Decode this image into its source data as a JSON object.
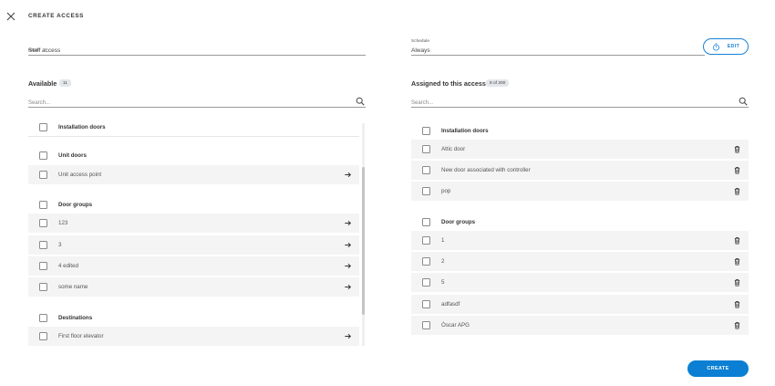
{
  "header": {
    "title": "CREATE ACCESS"
  },
  "name_field": {
    "label": "Name",
    "required_mark": "*",
    "value": "Staff access"
  },
  "schedule_field": {
    "label": "Schedule",
    "value": "Always",
    "edit_label": "EDIT"
  },
  "available": {
    "title": "Available",
    "count": "11",
    "search_placeholder": "Search...",
    "rows": [
      {
        "type": "group",
        "label": "Installation doors"
      },
      {
        "type": "group",
        "label": "Unit doors"
      },
      {
        "type": "item",
        "label": "Unit access point"
      },
      {
        "type": "group",
        "label": "Door groups"
      },
      {
        "type": "item",
        "label": "123"
      },
      {
        "type": "item",
        "label": "3"
      },
      {
        "type": "item",
        "label": "4 edited"
      },
      {
        "type": "item",
        "label": "some name"
      },
      {
        "type": "group",
        "label": "Destinations"
      },
      {
        "type": "item",
        "label": "First floor elevator"
      }
    ]
  },
  "assigned": {
    "title": "Assigned to this access",
    "count": "8 of 200",
    "search_placeholder": "Search...",
    "rows": [
      {
        "type": "group",
        "label": "Installation doors"
      },
      {
        "type": "item",
        "label": "Attic door"
      },
      {
        "type": "item",
        "label": "New door associated with controller"
      },
      {
        "type": "item",
        "label": "pop"
      },
      {
        "type": "group",
        "label": "Door groups"
      },
      {
        "type": "item",
        "label": "1"
      },
      {
        "type": "item",
        "label": "2"
      },
      {
        "type": "item",
        "label": "5"
      },
      {
        "type": "item",
        "label": "adfasdf"
      },
      {
        "type": "item",
        "label": "Òscar APG"
      }
    ]
  },
  "footer": {
    "create_label": "CREATE"
  },
  "colors": {
    "accent": "#0b7fd3",
    "row_bg": "#f4f4f4",
    "required": "#e04040"
  }
}
